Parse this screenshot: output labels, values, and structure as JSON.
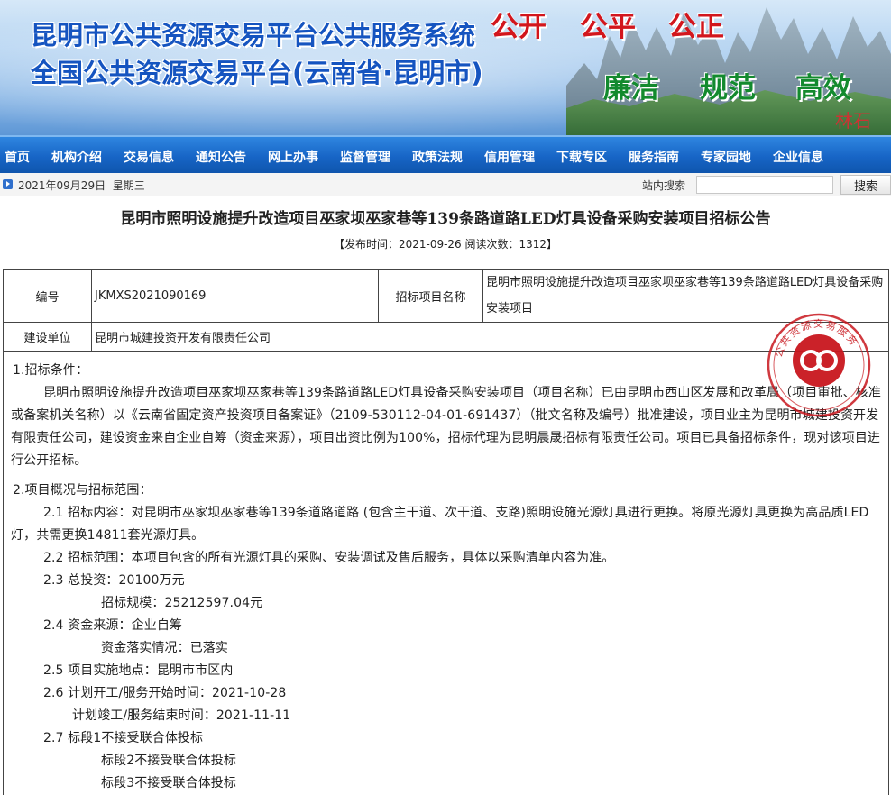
{
  "banner": {
    "title_line1": "昆明市公共资源交易平台公共服务系统",
    "title_line2": "全国公共资源交易平台(云南省·昆明市)",
    "slogans_top": [
      "公开",
      "公平",
      "公正"
    ],
    "slogans_bottom": [
      "廉洁",
      "规范",
      "高效"
    ],
    "stone_label": "林石"
  },
  "nav": {
    "items": [
      "首页",
      "机构介绍",
      "交易信息",
      "通知公告",
      "网上办事",
      "监督管理",
      "政策法规",
      "信用管理",
      "下载专区",
      "服务指南",
      "专家园地",
      "企业信息"
    ]
  },
  "strip": {
    "date": "2021年09月29日",
    "weekday": "星期三",
    "search_label": "站内搜索",
    "search_value": "",
    "search_button": "搜索"
  },
  "article": {
    "title": "昆明市照明设施提升改造项目巫家坝巫家巷等139条路道路LED灯具设备采购安装项目招标公告",
    "meta": "【发布时间：2021-09-26  阅读次数：1312】"
  },
  "info": {
    "code_label": "编号",
    "code_value": "JKMXS2021090169",
    "name_label": "招标项目名称",
    "name_value": "昆明市照明设施提升改造项目巫家坝巫家巷等139条路道路LED灯具设备采购安装项目",
    "owner_label": "建设单位",
    "owner_value": "昆明市城建投资开发有限责任公司"
  },
  "content": {
    "sec1_title": "1.招标条件：",
    "sec1_text": "昆明市照明设施提升改造项目巫家坝巫家巷等139条路道路LED灯具设备采购安装项目（项目名称）已由昆明市西山区发展和改革局（项目审批、核准或备案机关名称）以《云南省固定资产投资项目备案证》（2109-530112-04-01-691437）（批文名称及编号）批准建设，项目业主为昆明市城建投资开发有限责任公司，建设资金来自企业自筹（资金来源），项目出资比例为100%，招标代理为昆明晨晟招标有限责任公司。项目已具备招标条件，现对该项目进行公开招标。",
    "sec2_title": "2.项目概况与招标范围：",
    "s21": "2.1 招标内容：对昆明市巫家坝巫家巷等139条道路道路 (包含主干道、次干道、支路)照明设施光源灯具进行更换。将原光源灯具更换为高品质LED灯，共需更换14811套光源灯具。",
    "s22": "2.2 招标范围：本项目包含的所有光源灯具的采购、安装调试及售后服务，具体以采购清单内容为准。",
    "s23": "2.3 总投资：20100万元",
    "s23b": "招标规模：25212597.04元",
    "s24": "2.4 资金来源：企业自筹",
    "s24b": "资金落实情况：已落实",
    "s25": "2.5 项目实施地点：昆明市市区内",
    "s26": "2.6 计划开工/服务开始时间：2021-10-28",
    "s26b": "计划竣工/服务结束时间：2021-11-11",
    "s27": "2.7 标段1不接受联合体投标",
    "s27b": "标段2不接受联合体投标",
    "s27c": "标段3不接受联合体投标"
  },
  "stamp": {
    "ring_text": "公共资源交易服务",
    "color": "#c8161d"
  },
  "colors": {
    "nav_bg": "#1765c6",
    "banner_title": "#1554c0",
    "slogan_red": "#d2161d",
    "slogan_green": "#138a2e"
  }
}
